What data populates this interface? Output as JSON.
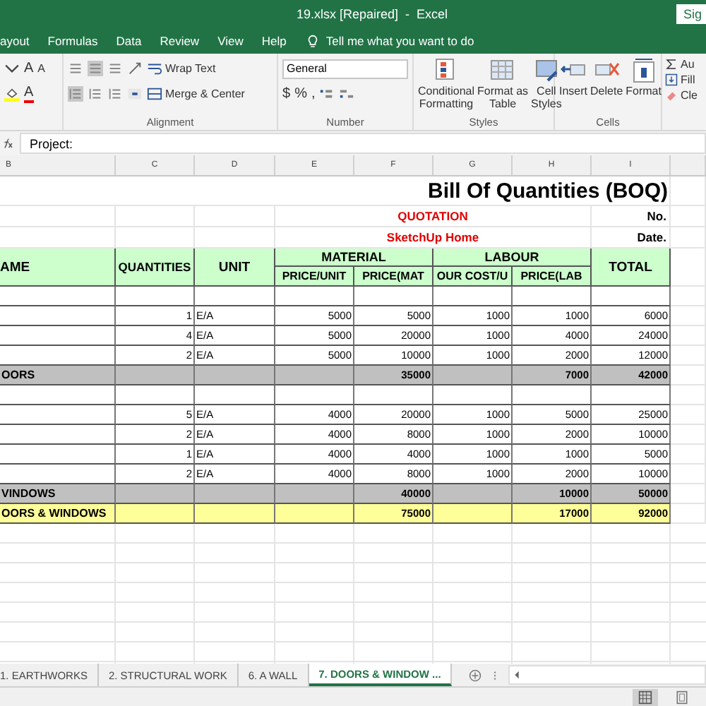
{
  "title_bar": {
    "title": "19.xlsx [Repaired]  -  Excel",
    "sign_in": "Sig"
  },
  "ribbon_tabs": [
    "ayout",
    "Formulas",
    "Data",
    "Review",
    "View",
    "Help"
  ],
  "tell_me": "Tell me what you want to do",
  "ribbon": {
    "font": {
      "grow": "A",
      "shrink": "A",
      "font_color": "A"
    },
    "alignment": {
      "wrap_text": "Wrap Text",
      "merge": "Merge & Center",
      "label": "Alignment"
    },
    "number": {
      "format": "General",
      "currency": "$",
      "percent": "%",
      "comma": ",",
      "label": "Number"
    },
    "styles": {
      "buttons": [
        {
          "line1": "Conditional",
          "line2": "Formatting",
          "kind": "conditional"
        },
        {
          "line1": "Format as",
          "line2": "Table",
          "kind": "table"
        },
        {
          "line1": "Cell",
          "line2": "Styles",
          "kind": "cell"
        }
      ],
      "label": "Styles"
    },
    "cells": {
      "buttons": [
        {
          "label": "Insert",
          "kind": "insert"
        },
        {
          "label": "Delete",
          "kind": "delete"
        },
        {
          "label": "Format",
          "kind": "format"
        }
      ],
      "label": "Cells"
    },
    "editing": {
      "autosum": "Au",
      "fill": "Fill",
      "clear": "Cle"
    }
  },
  "formula_bar": {
    "value": "Project:"
  },
  "column_headers": [
    "B",
    "C",
    "D",
    "E",
    "F",
    "G",
    "H",
    "I"
  ],
  "sheet": {
    "title": "Bill Of Quantities (BOQ)",
    "quotation": "QUOTATION",
    "no_label": "No.",
    "project": "SketchUp Home",
    "date_label": "Date.",
    "header": {
      "name": "AME",
      "quantities": "QUANTITIES",
      "unit": "UNIT",
      "material": "MATERIAL",
      "labour": "LABOUR",
      "total": "TOTAL",
      "mat_price": "PRICE/UNIT",
      "mat_amount": "PRICE(MAT",
      "lab_cost": "OUR COST/U",
      "lab_amount": "PRICE(LAB"
    },
    "rows": [
      {
        "kind": "blank"
      },
      {
        "kind": "item",
        "qty": "1",
        "unit": "E/A",
        "mat_price": "5000",
        "mat_amount": "5000",
        "lab_cost": "1000",
        "lab_amount": "1000",
        "total": "6000"
      },
      {
        "kind": "item",
        "qty": "4",
        "unit": "E/A",
        "mat_price": "5000",
        "mat_amount": "20000",
        "lab_cost": "1000",
        "lab_amount": "4000",
        "total": "24000"
      },
      {
        "kind": "item",
        "qty": "2",
        "unit": "E/A",
        "mat_price": "5000",
        "mat_amount": "10000",
        "lab_cost": "1000",
        "lab_amount": "2000",
        "total": "12000"
      },
      {
        "kind": "subtotal",
        "name": "OORS",
        "mat_amount": "35000",
        "lab_amount": "7000",
        "total": "42000"
      },
      {
        "kind": "blank"
      },
      {
        "kind": "item",
        "qty": "5",
        "unit": "E/A",
        "mat_price": "4000",
        "mat_amount": "20000",
        "lab_cost": "1000",
        "lab_amount": "5000",
        "total": "25000"
      },
      {
        "kind": "item",
        "qty": "2",
        "unit": "E/A",
        "mat_price": "4000",
        "mat_amount": "8000",
        "lab_cost": "1000",
        "lab_amount": "2000",
        "total": "10000"
      },
      {
        "kind": "item",
        "qty": "1",
        "unit": "E/A",
        "mat_price": "4000",
        "mat_amount": "4000",
        "lab_cost": "1000",
        "lab_amount": "1000",
        "total": "5000"
      },
      {
        "kind": "item",
        "qty": "2",
        "unit": "E/A",
        "mat_price": "4000",
        "mat_amount": "8000",
        "lab_cost": "1000",
        "lab_amount": "2000",
        "total": "10000"
      },
      {
        "kind": "subtotal",
        "name": "VINDOWS",
        "mat_amount": "40000",
        "lab_amount": "10000",
        "total": "50000"
      },
      {
        "kind": "grand_total",
        "name": "OORS & WINDOWS",
        "mat_amount": "75000",
        "lab_amount": "17000",
        "total": "92000"
      }
    ]
  },
  "sheet_tabs": [
    {
      "label": "1. EARTHWORKS",
      "selected": false
    },
    {
      "label": "2. STRUCTURAL WORK",
      "selected": false
    },
    {
      "label": "6. A WALL",
      "selected": false
    },
    {
      "label": "7. DOORS & WINDOW ...",
      "selected": true
    }
  ]
}
